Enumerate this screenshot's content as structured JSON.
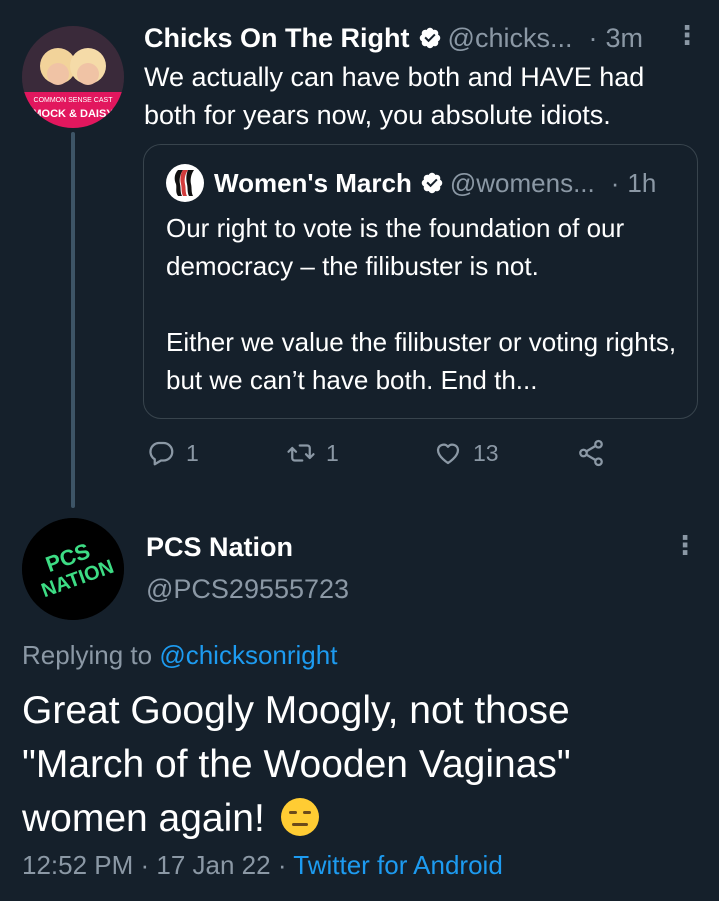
{
  "tweet1": {
    "author_name": "Chicks On The Right",
    "handle": "@chicks...",
    "time": "3m",
    "text": "We actually can have both and HAVE had both for years now, you absolute idiots.",
    "avatar_caption_top": "COMMON SENSE CAST",
    "avatar_caption_bottom": "MOCK & DAISY",
    "quote": {
      "author_name": "Women's March",
      "handle": "@womens...",
      "time": "1h",
      "paragraph1": "Our right to vote is the foundation of our democracy – the filibuster is not.",
      "paragraph2": "Either we value the filibuster or voting rights, but we can’t have both. End th..."
    },
    "actions": {
      "reply_count": "1",
      "retweet_count": "1",
      "like_count": "13"
    }
  },
  "tweet2": {
    "author_name": "PCS Nation",
    "handle": "@PCS29555723",
    "avatar_text_top": "PCS",
    "avatar_text_bottom": "NATION",
    "replying_prefix": "Replying to",
    "replying_to": "@chicksonright",
    "text": "Great Googly Moogly, not those \"March of the Wooden Vaginas\" women again!",
    "timestamp": "12:52 PM · 17 Jan 22 ·",
    "client": "Twitter for Android"
  },
  "colors": {
    "background": "#15202b",
    "text_primary": "#ffffff",
    "text_secondary": "#8b98a5",
    "link": "#1d9bf0",
    "border": "#38444d",
    "avatar_green": "#3ddc84"
  },
  "icons": [
    "verified-badge-icon",
    "more-options-icon",
    "reply-icon",
    "retweet-icon",
    "like-icon",
    "share-icon",
    "expressionless-face-emoji"
  ]
}
